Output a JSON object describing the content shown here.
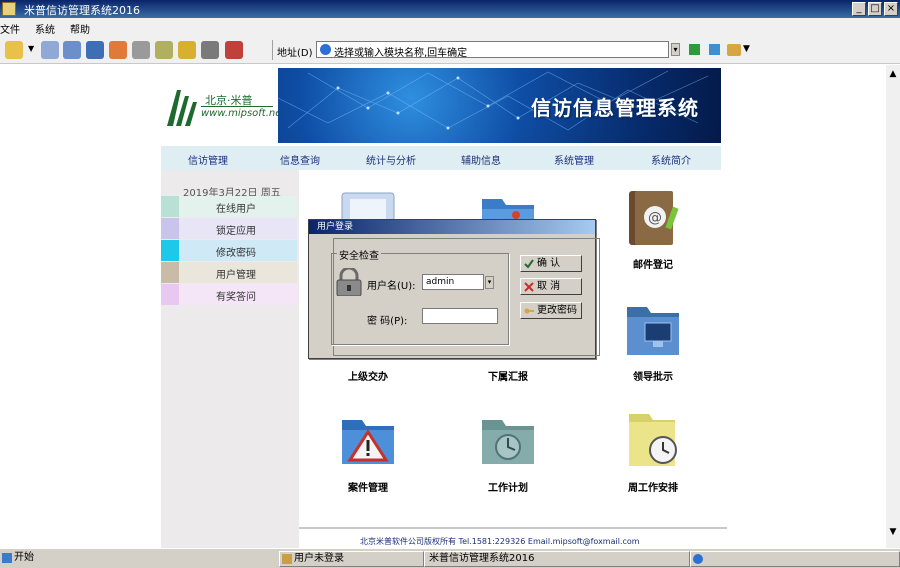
{
  "window": {
    "title": "米普信访管理系统2016",
    "controls": {
      "minimize": "_",
      "maximize": "□",
      "close": "×"
    }
  },
  "menu": {
    "items": [
      "文件",
      "系统",
      "帮助"
    ]
  },
  "toolbar": {
    "icons": [
      "back-icon",
      "dropdown-arrow-icon",
      "list-icon",
      "network-icon",
      "monitor-icon",
      "home-icon",
      "print-icon",
      "tools-icon",
      "lock-icon",
      "user-lock-icon",
      "exit-icon"
    ],
    "address_label": "地址(D)",
    "address_value": "选择或输入模块名称,回车确定",
    "go_icon": "go-icon",
    "fav_icon": "favorites-icon"
  },
  "header": {
    "logo_cn": "北京·米普",
    "logo_url": "www.mipsoft.net",
    "banner_title": "信访信息管理系统"
  },
  "nav": {
    "items": [
      "信访管理",
      "信息查询",
      "统计与分析",
      "辅助信息",
      "系统管理",
      "系统简介"
    ]
  },
  "sidebar": {
    "date": "2019年3月22日  周五",
    "items": [
      {
        "label": "在线用户",
        "color": "#b9e0d4"
      },
      {
        "label": "锁定应用",
        "color": "#c8c4ec"
      },
      {
        "label": "修改密码",
        "color": "#1ec8e8"
      },
      {
        "label": "用户管理",
        "color": "#c8bca8"
      },
      {
        "label": "有奖答问",
        "color": "#e8c8f0"
      }
    ]
  },
  "grid": {
    "items": [
      {
        "label": "",
        "icon": "folder-light-icon"
      },
      {
        "label": "",
        "icon": "folder-blue-icon"
      },
      {
        "label": "邮件登记",
        "icon": "address-book-icon"
      },
      {
        "label": "上级交办",
        "icon": "folder-icon"
      },
      {
        "label": "下属汇报",
        "icon": "folder-icon"
      },
      {
        "label": "领导批示",
        "icon": "folder-monitor-icon"
      },
      {
        "label": "案件管理",
        "icon": "folder-warning-icon"
      },
      {
        "label": "工作计划",
        "icon": "folder-clock-icon"
      },
      {
        "label": "周工作安排",
        "icon": "folder-alarm-icon"
      }
    ]
  },
  "footer": {
    "text": "北京米普软件公司版权所有   Tel.1581:229326   Email.mipsoft@foxmail.com"
  },
  "dialog": {
    "title": "用户登录",
    "group_label": "安全检查",
    "username_label": "用户名(U):",
    "username_value": "admin",
    "password_label": "密  码(P):",
    "ok_label": "确 认",
    "cancel_label": "取 消",
    "change_pwd_label": "更改密码"
  },
  "taskbar": {
    "start": "开始",
    "segment_user": "用户未登录",
    "segment_app": "米普信访管理系统2016"
  }
}
